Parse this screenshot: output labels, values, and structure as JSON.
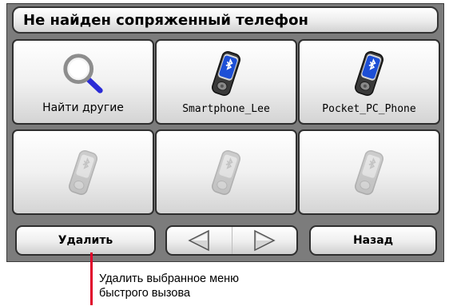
{
  "title": "Не найден сопряженный телефон",
  "tiles": [
    {
      "label": "Найти другие",
      "icon": "magnifier-icon"
    },
    {
      "label": "Smartphone_Lee",
      "icon": "bluetooth-phone-icon"
    },
    {
      "label": "Pocket_PC_Phone",
      "icon": "bluetooth-phone-icon"
    },
    {
      "label": "",
      "icon": "bluetooth-phone-disabled-icon"
    },
    {
      "label": "",
      "icon": "bluetooth-phone-disabled-icon"
    },
    {
      "label": "",
      "icon": "bluetooth-phone-disabled-icon"
    }
  ],
  "bottom": {
    "delete_label": "Удалить",
    "back_label": "Назад"
  },
  "callout": {
    "line1": "Удалить выбранное меню",
    "line2": "быстрого вызова"
  },
  "colors": {
    "pointer": "#e0002a",
    "bluetooth": "#1d4fd6",
    "phone": "#2b2b2b"
  }
}
